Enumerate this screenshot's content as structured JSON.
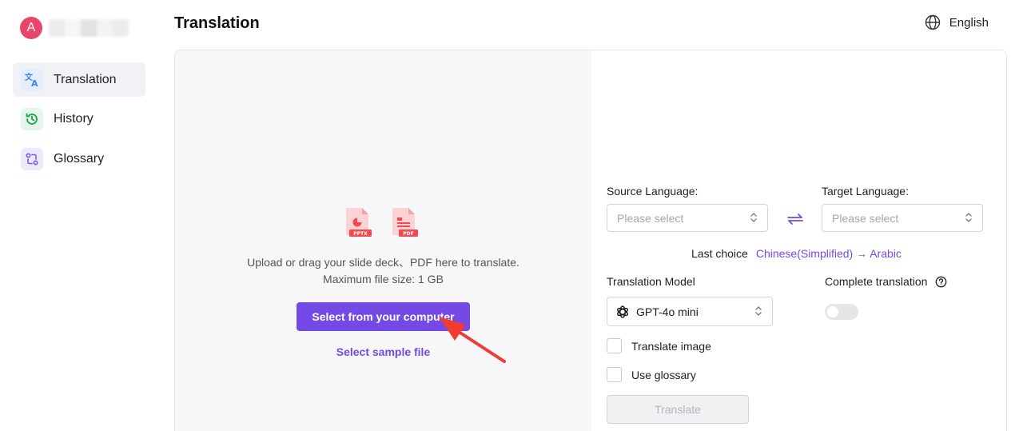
{
  "user": {
    "avatar_initial": "A"
  },
  "sidebar": {
    "items": [
      {
        "label": "Translation",
        "icon": "translate-icon",
        "active": true,
        "color": "#3b82f6"
      },
      {
        "label": "History",
        "icon": "history-icon",
        "active": false,
        "color": "#16a34a"
      },
      {
        "label": "Glossary",
        "icon": "glossary-icon",
        "active": false,
        "color": "#7c5ce6"
      }
    ]
  },
  "header": {
    "title": "Translation",
    "language": "English",
    "language_icon": "globe-icon"
  },
  "upload": {
    "file_types": [
      "PPTX",
      "PDF"
    ],
    "instruction": "Upload or drag your slide deck、PDF here to translate.",
    "max_size": "Maximum file size: 1 GB",
    "select_button": "Select from your computer",
    "sample_link": "Select sample file"
  },
  "settings": {
    "source_language_label": "Source Language:",
    "source_placeholder": "Please select",
    "target_language_label": "Target Language:",
    "target_placeholder": "Please select",
    "last_choice_label": "Last choice",
    "last_choice_value": "Chinese(Simplified) → Arabic",
    "model_label": "Translation Model",
    "model_value": "GPT-4o mini",
    "complete_translation_label": "Complete translation",
    "complete_translation_on": false,
    "translate_image_label": "Translate image",
    "use_glossary_label": "Use glossary",
    "translate_button": "Translate"
  },
  "colors": {
    "accent": "#7449e6",
    "avatar": "#e8456b",
    "file_icon": "#f5484f"
  }
}
